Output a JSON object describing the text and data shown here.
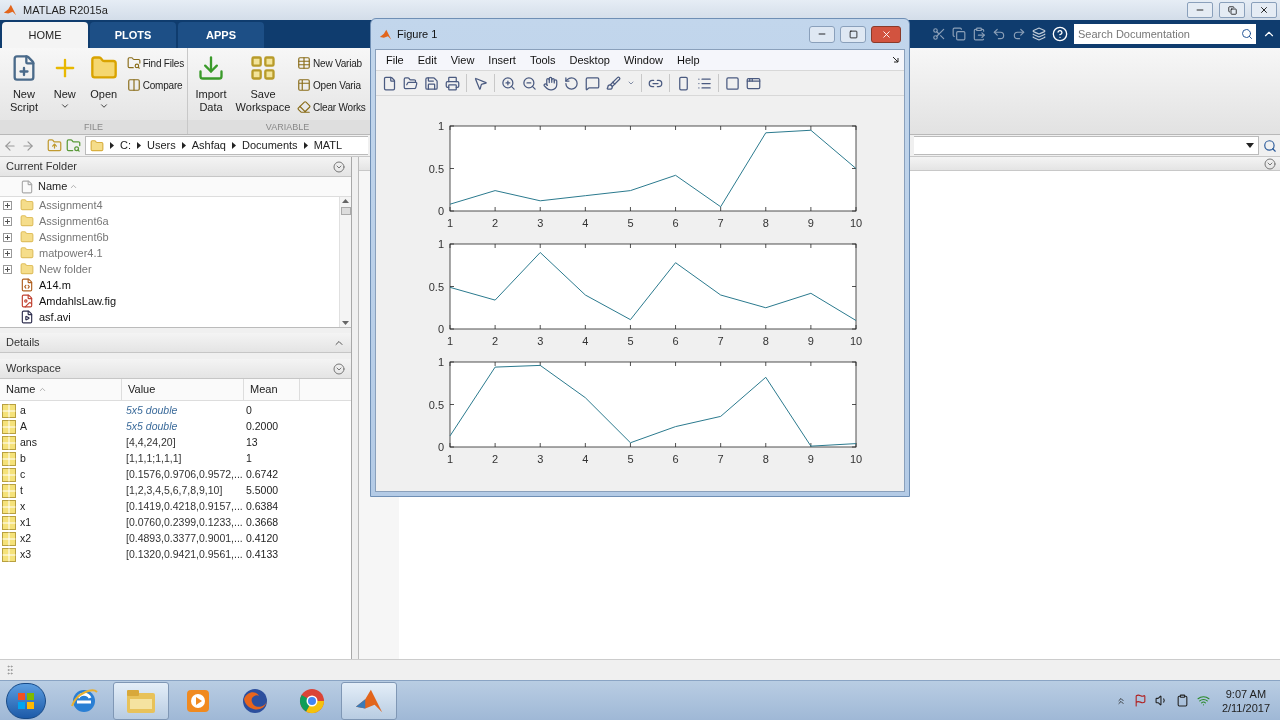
{
  "window": {
    "title": "MATLAB R2015a"
  },
  "tabs": [
    {
      "label": "HOME",
      "selected": true
    },
    {
      "label": "PLOTS",
      "selected": false
    },
    {
      "label": "APPS",
      "selected": false
    }
  ],
  "search": {
    "placeholder": "Search Documentation"
  },
  "toolstrip": [
    {
      "label": "FILE",
      "large": [
        {
          "label": "New Script",
          "menu": false
        },
        {
          "label": "New",
          "menu": true
        },
        {
          "label": "Open",
          "menu": true
        }
      ],
      "small": [
        "Find Files",
        "Compare"
      ]
    },
    {
      "label": "VARIABLE",
      "large": [
        {
          "label": "Import Data",
          "menu": false
        },
        {
          "label": "Save Workspace",
          "menu": false
        }
      ],
      "small": [
        "New Variab",
        "Open Varia",
        "Clear Works"
      ]
    }
  ],
  "address": {
    "path": [
      "C:",
      "Users",
      "Ashfaq",
      "Documents",
      "MATL"
    ]
  },
  "current_folder": {
    "title": "Current Folder",
    "column": "Name",
    "items": [
      {
        "name": "Assignment4",
        "kind": "folder",
        "expanded": false
      },
      {
        "name": "Assignment6a",
        "kind": "folder",
        "expanded": false
      },
      {
        "name": "Assignment6b",
        "kind": "folder",
        "expanded": false
      },
      {
        "name": "matpower4.1",
        "kind": "folder",
        "expanded": false
      },
      {
        "name": "New folder",
        "kind": "folder",
        "expanded": false
      },
      {
        "name": "A14.m",
        "kind": "script"
      },
      {
        "name": "AmdahlsLaw.fig",
        "kind": "figure"
      },
      {
        "name": "asf.avi",
        "kind": "video"
      }
    ]
  },
  "details": {
    "title": "Details"
  },
  "workspace": {
    "title": "Workspace",
    "columns": [
      "Name",
      "Value",
      "Mean"
    ],
    "rows": [
      {
        "name": "a",
        "value": "5x5 double",
        "kind": "summary",
        "mean": "0"
      },
      {
        "name": "A",
        "value": "5x5 double",
        "kind": "summary",
        "mean": "0.2000"
      },
      {
        "name": "ans",
        "value": "[4,4,24,20]",
        "kind": "literal",
        "mean": "13"
      },
      {
        "name": "b",
        "value": "[1,1,1;1,1,1]",
        "kind": "literal",
        "mean": "1"
      },
      {
        "name": "c",
        "value": "[0.1576,0.9706,0.9572,...",
        "kind": "literal",
        "mean": "0.6742"
      },
      {
        "name": "t",
        "value": "[1,2,3,4,5,6,7,8,9,10]",
        "kind": "literal",
        "mean": "5.5000"
      },
      {
        "name": "x",
        "value": "[0.1419,0.4218,0.9157,...",
        "kind": "literal",
        "mean": "0.6384"
      },
      {
        "name": "x1",
        "value": "[0.0760,0.2399,0.1233,...",
        "kind": "literal",
        "mean": "0.3668"
      },
      {
        "name": "x2",
        "value": "[0.4893,0.3377,0.9001,...",
        "kind": "literal",
        "mean": "0.4120"
      },
      {
        "name": "x3",
        "value": "[0.1320,0.9421,0.9561,...",
        "kind": "literal",
        "mean": "0.4133"
      }
    ]
  },
  "figure": {
    "title": "Figure 1",
    "menu": [
      "File",
      "Edit",
      "View",
      "Insert",
      "Tools",
      "Desktop",
      "Window",
      "Help"
    ],
    "plots": [
      {
        "chart_data": {
          "type": "line",
          "x": [
            1,
            2,
            3,
            4,
            5,
            6,
            7,
            8,
            9,
            10
          ],
          "xlim": [
            1,
            10
          ],
          "ylim": [
            0,
            1
          ],
          "xticks": [
            1,
            2,
            3,
            4,
            5,
            6,
            7,
            8,
            9,
            10
          ],
          "yticks": [
            0,
            0.5,
            1
          ],
          "series": [
            {
              "color": "#2b7a8e",
              "values": [
                0.08,
                0.24,
                0.12,
                0.18,
                0.24,
                0.42,
                0.05,
                0.92,
                0.95,
                0.5
              ]
            }
          ]
        }
      },
      {
        "chart_data": {
          "type": "line",
          "x": [
            1,
            2,
            3,
            4,
            5,
            6,
            7,
            8,
            9,
            10
          ],
          "xlim": [
            1,
            10
          ],
          "ylim": [
            0,
            1
          ],
          "xticks": [
            1,
            2,
            3,
            4,
            5,
            6,
            7,
            8,
            9,
            10
          ],
          "yticks": [
            0,
            0.5,
            1
          ],
          "series": [
            {
              "color": "#2b7a8e",
              "values": [
                0.49,
                0.34,
                0.9,
                0.4,
                0.11,
                0.78,
                0.4,
                0.25,
                0.42,
                0.1
              ]
            }
          ]
        }
      },
      {
        "chart_data": {
          "type": "line",
          "x": [
            1,
            2,
            3,
            4,
            5,
            6,
            7,
            8,
            9,
            10
          ],
          "xlim": [
            1,
            10
          ],
          "ylim": [
            0,
            1
          ],
          "xticks": [
            1,
            2,
            3,
            4,
            5,
            6,
            7,
            8,
            9,
            10
          ],
          "yticks": [
            0,
            0.5,
            1
          ],
          "series": [
            {
              "color": "#2b7a8e",
              "values": [
                0.13,
                0.94,
                0.96,
                0.58,
                0.05,
                0.24,
                0.36,
                0.82,
                0.01,
                0.04
              ]
            }
          ]
        }
      }
    ]
  },
  "taskbar": {
    "apps": [
      {
        "kind": "browser-e",
        "running": false
      },
      {
        "kind": "explorer",
        "running": true
      },
      {
        "kind": "media",
        "running": false
      },
      {
        "kind": "fox",
        "running": false
      },
      {
        "kind": "chrome",
        "running": false
      },
      {
        "kind": "matlab",
        "running": true
      }
    ],
    "time": "9:07 AM",
    "date": "2/11/2017"
  }
}
